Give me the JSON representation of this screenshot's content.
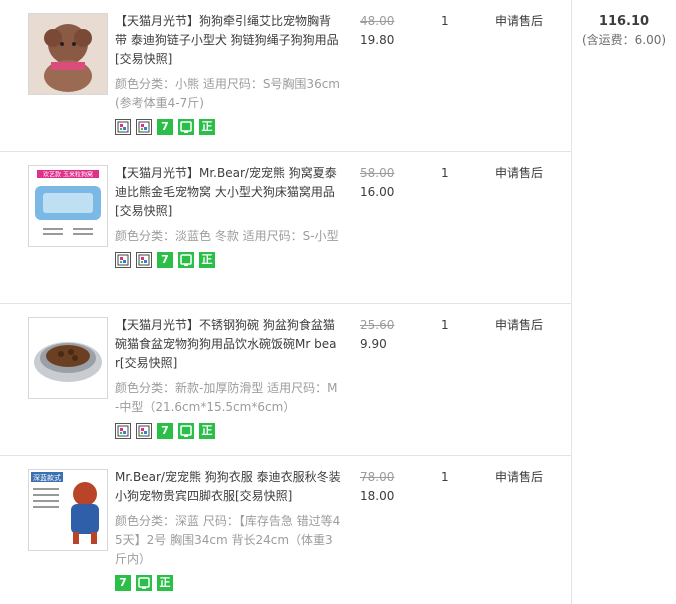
{
  "order": {
    "total": "116.10",
    "shipping_note": "(含运费：6.00)",
    "items": [
      {
        "title": "【天猫月光节】狗狗牵引绳艾比宠物胸背带 泰迪狗链子小型犬 狗链狗绳子狗狗用品[交易快照]",
        "sku": "颜色分类：小熊 适用尺码：S号胸围36cm(参考体重4-7斤)",
        "original_price": "48.00",
        "price": "19.80",
        "quantity": "1",
        "after_sale": "申请售后",
        "badges": [
          "snapshot-icon",
          "snapshot-icon",
          "seven-day-return-icon",
          "guarantee-icon",
          "authentic-icon"
        ],
        "thumb_icon": "dog-harness-photo"
      },
      {
        "title": "【天猫月光节】Mr.Bear/宠宠熊 狗窝夏泰迪比熊金毛宠物窝 大小型犬狗床猫窝用品[交易快照]",
        "sku": "颜色分类：淡蓝色 冬款 适用尺码：S-小型",
        "original_price": "58.00",
        "price": "16.00",
        "quantity": "1",
        "after_sale": "申请售后",
        "badges": [
          "snapshot-icon",
          "snapshot-icon",
          "seven-day-return-icon",
          "guarantee-icon",
          "authentic-icon"
        ],
        "thumb_icon": "pet-bed-photo"
      },
      {
        "title": "【天猫月光节】不锈钢狗碗 狗盆狗食盆猫碗猫食盆宠物狗狗用品饮水碗饭碗Mr bear[交易快照]",
        "sku": "颜色分类：新款-加厚防滑型 适用尺码：M-中型（21.6cm*15.5cm*6cm）",
        "original_price": "25.60",
        "price": "9.90",
        "quantity": "1",
        "after_sale": "申请售后",
        "badges": [
          "snapshot-icon",
          "snapshot-icon",
          "seven-day-return-icon",
          "guarantee-icon",
          "authentic-icon"
        ],
        "thumb_icon": "dog-bowl-photo"
      },
      {
        "title": "Mr.Bear/宠宠熊 狗狗衣服 泰迪衣服秋冬装小狗宠物贵宾四脚衣服[交易快照]",
        "sku": "颜色分类：深蓝 尺码：【库存告急 错过等45天】2号 胸围34cm 背长24cm（体重3斤内）",
        "original_price": "78.00",
        "price": "18.00",
        "quantity": "1",
        "after_sale": "申请售后",
        "badges": [
          "seven-day-return-icon",
          "guarantee-icon",
          "authentic-icon"
        ],
        "thumb_icon": "dog-clothes-photo",
        "thumb_text": "深蓝款式"
      }
    ],
    "badge_text": {
      "seven_day": "7",
      "authentic": "正"
    },
    "thumb_labels": {
      "bed_banner": "欢艺款 玉米粒狗窝"
    }
  }
}
